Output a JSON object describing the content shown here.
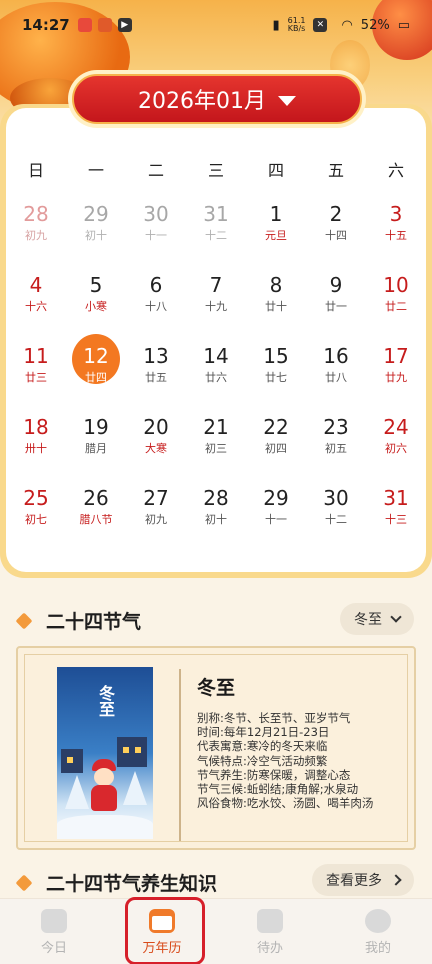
{
  "status_bar": {
    "time": "14:27",
    "net_speed_top": "61.1",
    "net_speed_unit": "KB/s",
    "battery": "52%"
  },
  "header": {
    "month_label": "2026年01月"
  },
  "calendar": {
    "weekdays": [
      "日",
      "一",
      "二",
      "三",
      "四",
      "五",
      "六"
    ],
    "days": [
      {
        "d": "28",
        "l": "初九",
        "other": true
      },
      {
        "d": "29",
        "l": "初十",
        "other": true
      },
      {
        "d": "30",
        "l": "十一",
        "other": true
      },
      {
        "d": "31",
        "l": "十二",
        "other": true
      },
      {
        "d": "1",
        "l": "元旦",
        "fest": true
      },
      {
        "d": "2",
        "l": "十四"
      },
      {
        "d": "3",
        "l": "十五"
      },
      {
        "d": "4",
        "l": "十六"
      },
      {
        "d": "5",
        "l": "小寒",
        "fest": true
      },
      {
        "d": "6",
        "l": "十八"
      },
      {
        "d": "7",
        "l": "十九"
      },
      {
        "d": "8",
        "l": "廿十"
      },
      {
        "d": "9",
        "l": "廿一"
      },
      {
        "d": "10",
        "l": "廿二"
      },
      {
        "d": "11",
        "l": "廿三"
      },
      {
        "d": "12",
        "l": "廿四",
        "today": true
      },
      {
        "d": "13",
        "l": "廿五"
      },
      {
        "d": "14",
        "l": "廿六"
      },
      {
        "d": "15",
        "l": "廿七"
      },
      {
        "d": "16",
        "l": "廿八"
      },
      {
        "d": "17",
        "l": "廿九"
      },
      {
        "d": "18",
        "l": "卅十"
      },
      {
        "d": "19",
        "l": "腊月"
      },
      {
        "d": "20",
        "l": "大寒",
        "fest": true
      },
      {
        "d": "21",
        "l": "初三"
      },
      {
        "d": "22",
        "l": "初四"
      },
      {
        "d": "23",
        "l": "初五"
      },
      {
        "d": "24",
        "l": "初六"
      },
      {
        "d": "25",
        "l": "初七"
      },
      {
        "d": "26",
        "l": "腊八节",
        "fest": true
      },
      {
        "d": "27",
        "l": "初九"
      },
      {
        "d": "28",
        "l": "初十"
      },
      {
        "d": "29",
        "l": "十一"
      },
      {
        "d": "30",
        "l": "十二"
      },
      {
        "d": "31",
        "l": "十三"
      }
    ]
  },
  "solar_terms": {
    "title": "二十四节气",
    "selector_label": "冬至",
    "poster_text": "冬至",
    "name": "冬至",
    "lines": [
      "别称:冬节、长至节、亚岁节气",
      "时间:每年12月21日-23日",
      "代表寓意:寒冷的冬天来临",
      "气候特点:冷空气活动频繁",
      "节气养生:防寒保暖，调整心态",
      "节气三候:蚯蚓结;康角解;水泉动",
      "风俗食物:吃水饺、汤圆、喝羊肉汤"
    ]
  },
  "health_section": {
    "title": "二十四节气养生知识",
    "more_label": "查看更多"
  },
  "tabbar": {
    "tabs": [
      {
        "label": "今日"
      },
      {
        "label": "万年历"
      },
      {
        "label": "待办"
      },
      {
        "label": "我的"
      }
    ]
  },
  "colors": {
    "accent_red": "#c4161c",
    "today_orange": "#f37821",
    "card_gold": "#f9d98c"
  }
}
